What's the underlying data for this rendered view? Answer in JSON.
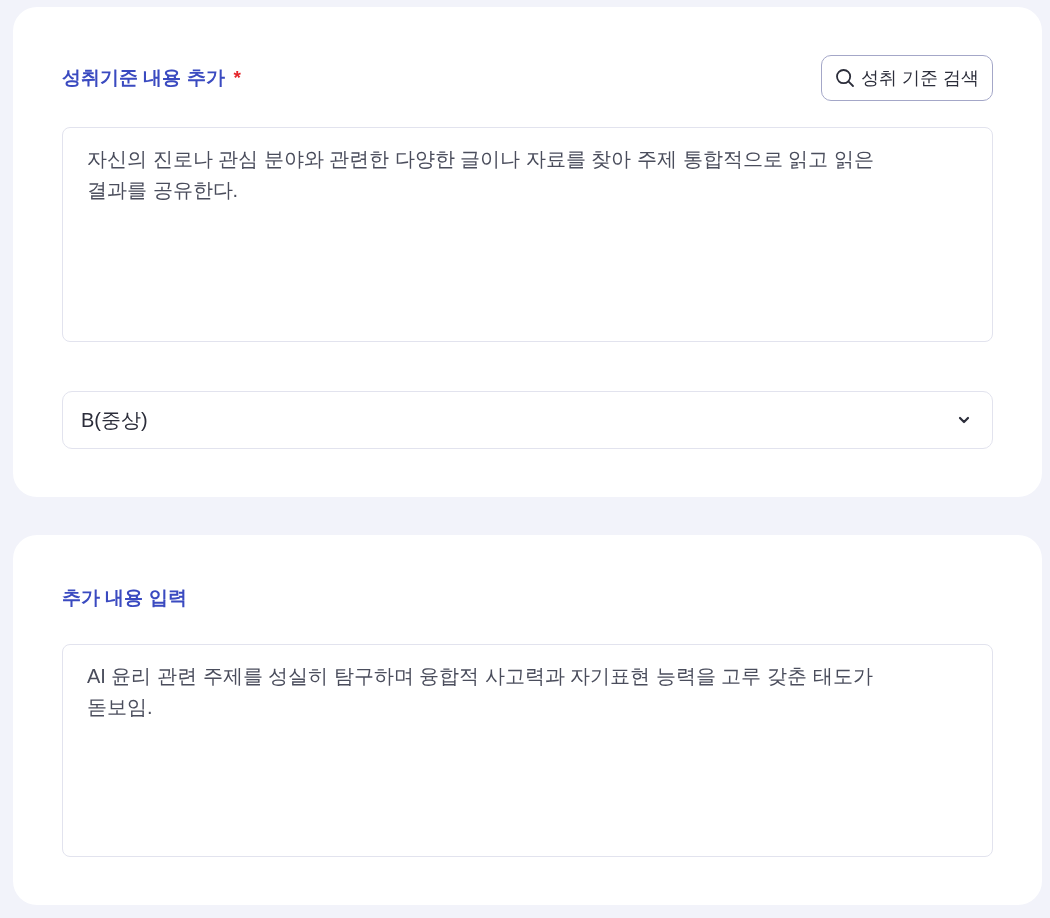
{
  "sections": [
    {
      "kind": "standard",
      "title": "성취기준 내용 추가",
      "required_mark": "*",
      "search_button": {
        "label": "성취 기준 검색"
      },
      "textarea": {
        "value": "자신의 진로나 관심 분야와 관련한 다양한 글이나 자료를 찾아 주제 통합적으로 읽고 읽은 결과를 공유한다."
      },
      "select": {
        "value": "B(중상)"
      }
    },
    {
      "kind": "extra",
      "title": "추가 내용 입력",
      "textarea": {
        "value": "AI 윤리 관련 주제를 성실히 탐구하며 융합적 사고력과 자기표현 능력을 고루 갖춘 태도가 돋보임."
      }
    }
  ]
}
